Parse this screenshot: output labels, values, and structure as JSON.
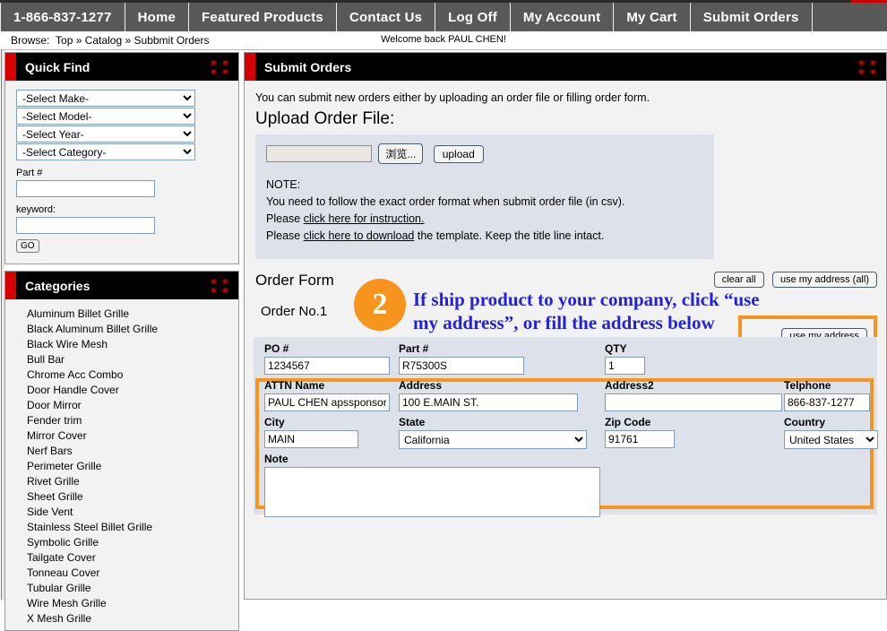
{
  "nav": {
    "items": [
      {
        "label": "1-866-837-1277",
        "name": "nav-phone"
      },
      {
        "label": "Home",
        "name": "nav-home"
      },
      {
        "label": "Featured Products",
        "name": "nav-featured-products"
      },
      {
        "label": "Contact Us",
        "name": "nav-contact-us"
      },
      {
        "label": "Log Off",
        "name": "nav-log-off"
      },
      {
        "label": "My Account",
        "name": "nav-my-account"
      },
      {
        "label": "My Cart",
        "name": "nav-my-cart"
      },
      {
        "label": "Submit Orders",
        "name": "nav-submit-orders"
      }
    ]
  },
  "browse": {
    "label": "Browse:",
    "crumb_top": "Top",
    "crumb_catalog": "Catalog",
    "crumb_current": "Subbmit Orders",
    "separator": "»",
    "welcome": "Welcome back PAUL CHEN!"
  },
  "quick_find": {
    "title": "Quick Find",
    "selects": [
      {
        "value": "-Select Make-",
        "name": "select-make"
      },
      {
        "value": "-Select Model-",
        "name": "select-model"
      },
      {
        "value": "-Select Year-",
        "name": "select-year"
      },
      {
        "value": "-Select Category-",
        "name": "select-category"
      }
    ],
    "part_label": "Part #",
    "part_value": "",
    "keyword_label": "keyword:",
    "keyword_value": "",
    "go_label": "GO"
  },
  "categories": {
    "title": "Categories",
    "items": [
      "Aluminum Billet Grille",
      "Black Aluminum Billet Grille",
      "Black Wire Mesh",
      "Bull Bar",
      "Chrome Acc Combo",
      "Door Handle Cover",
      "Door Mirror",
      "Fender trim",
      "Mirror Cover",
      "Nerf Bars",
      "Perimeter Grille",
      "Rivet Grille",
      "Sheet Grille",
      "Side Vent",
      "Stainless Steel Billet Grille",
      "Symbolic Grille",
      "Tailgate Cover",
      "Tonneau Cover",
      "Tubular Grille",
      "Wire Mesh Grille",
      "X Mesh Grille"
    ]
  },
  "main": {
    "title": "Submit Orders",
    "intro": "You can submit new orders either by uploading an order file or filling order form.",
    "upload_heading": "Upload Order File:",
    "file_value": "",
    "browse_label": "浏览...",
    "upload_label": "upload",
    "note_title": "NOTE:",
    "note_line1": "You need to follow the exact order format when submit order file (in csv).",
    "note_line2_prefix": "Please ",
    "note_line2_link": "click here for instruction.",
    "note_line3_prefix": "Please ",
    "note_line3_link": "click here to download",
    "note_line3_suffix": " the template. Keep the title line intact."
  },
  "order_form": {
    "heading": "Order Form",
    "order_no": "Order No.1",
    "badge_number": "2",
    "annotation": "If ship product to your company, click “use my address”, or fill the address below",
    "clear_all_label": "clear all",
    "use_my_address_all_label": "use my address (all)",
    "use_my_address_label": "use my address",
    "fields": {
      "po_label": "PO #",
      "po_value": "1234567",
      "part_label": "Part #",
      "part_value": "R75300S",
      "qty_label": "QTY",
      "qty_value": "1",
      "attn_label": "ATTN Name",
      "attn_value": "PAUL CHEN apssponsor",
      "address_label": "Address",
      "address_value": "100 E.MAIN ST.",
      "address2_label": "Address2",
      "address2_value": "",
      "telephone_label": "Telphone",
      "telephone_value": "866-837-1277",
      "city_label": "City",
      "city_value": "MAIN",
      "state_label": "State",
      "state_value": "California",
      "zip_label": "Zip Code",
      "zip_value": "91761",
      "country_label": "Country",
      "country_value": "United States",
      "note_label": "Note",
      "note_value": ""
    }
  },
  "colors": {
    "accent_orange": "#f7941e",
    "annotation_blue": "#2222dd",
    "panel_header_red": "#d60000",
    "nav_gray": "#595959",
    "field_panel_blue": "#dde1ea"
  }
}
